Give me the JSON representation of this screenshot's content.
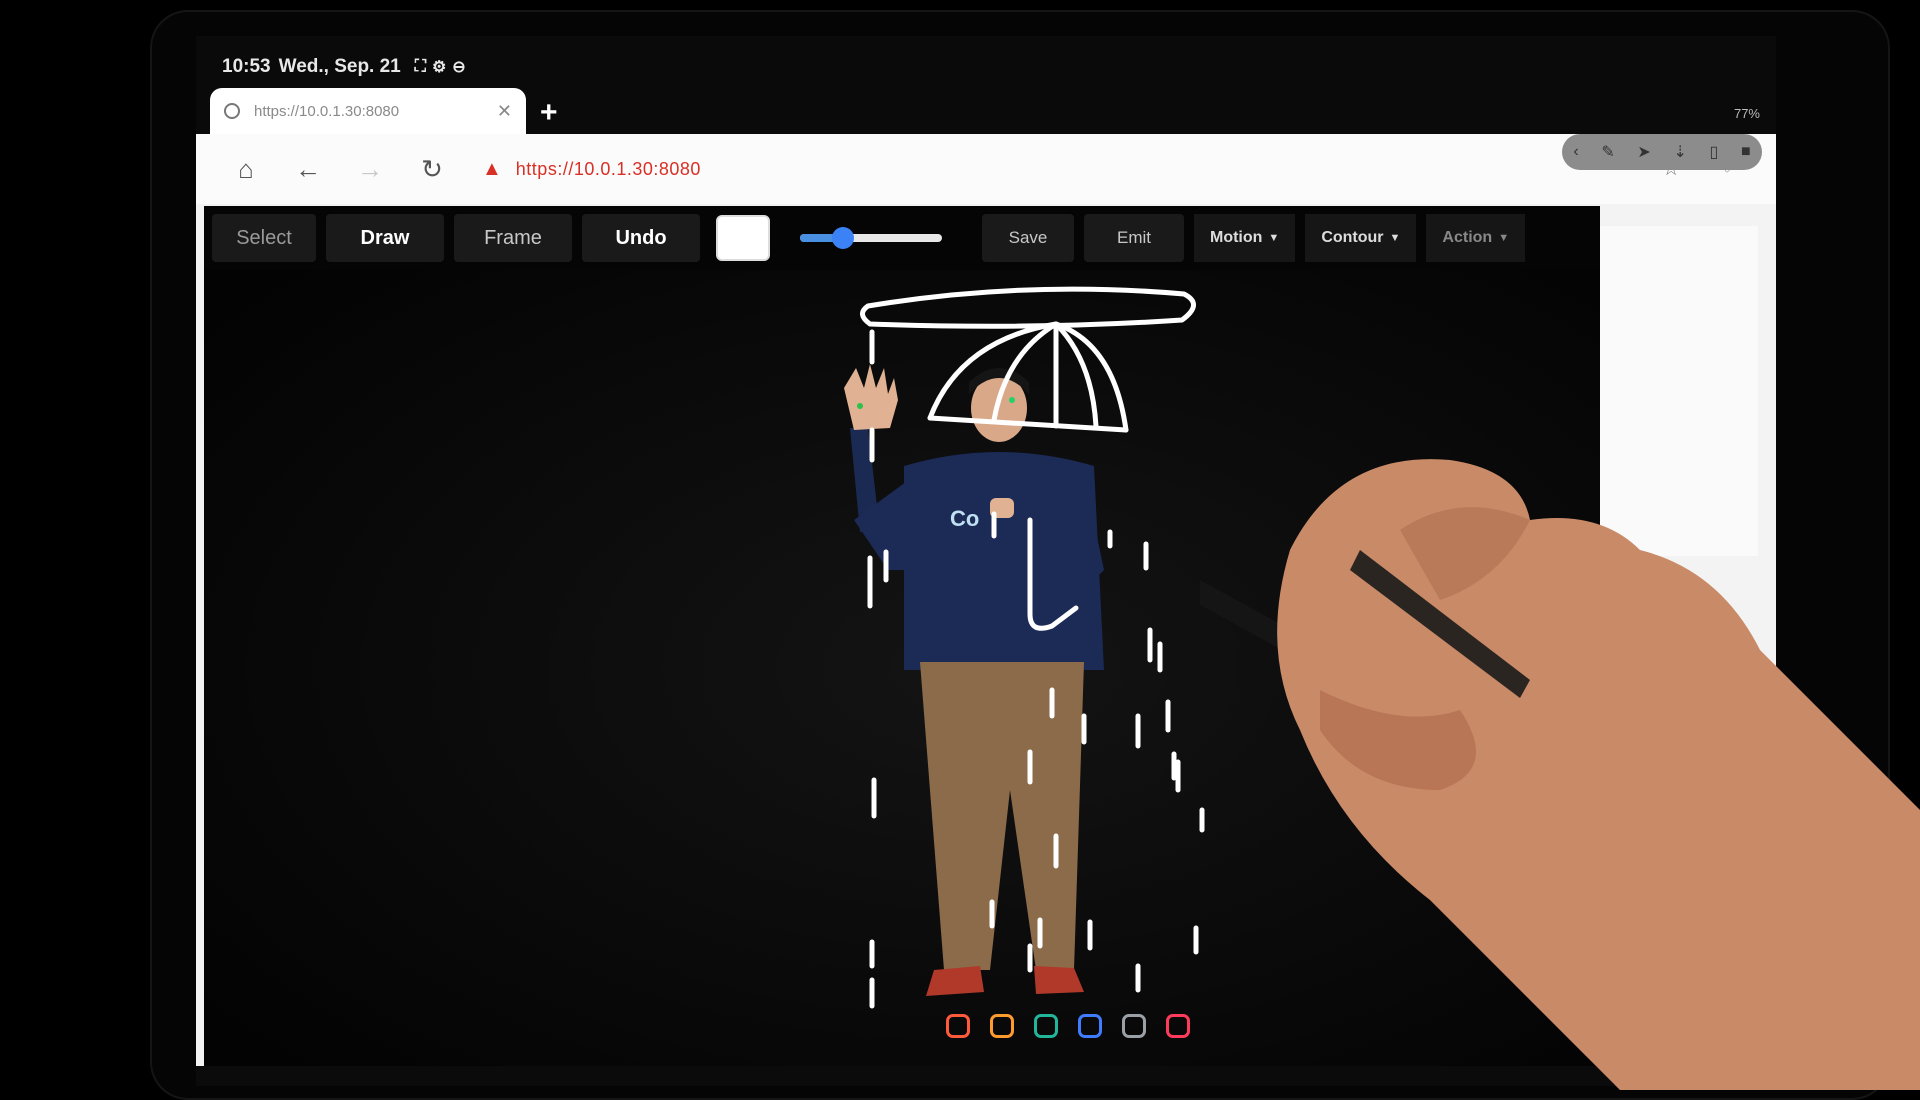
{
  "status_bar": {
    "time": "10:53",
    "date": "Wed., Sep. 21",
    "battery": "77%"
  },
  "browser": {
    "tab_title": "https://10.0.1.30:8080",
    "new_tab_label": "+",
    "url": "https://10.0.1.30:8080",
    "icons": [
      "home-icon",
      "back-icon",
      "forward-icon",
      "reload-icon",
      "warning-icon",
      "star-icon",
      "mic-icon"
    ]
  },
  "toolbar": {
    "select_label": "Select",
    "draw_label": "Draw",
    "frame_label": "Frame",
    "undo_label": "Undo",
    "color": "#ffffff",
    "brush_size": 0.3,
    "save_label": "Save",
    "emit_label": "Emit",
    "motion_label": "Motion",
    "contour_label": "Contour",
    "action_label": "Action"
  },
  "canvas": {
    "shirt_text": "Co",
    "drawing_color": "#ffffff"
  },
  "dock": {
    "icons": [
      {
        "name": "dock-app-1-icon",
        "color": "#ff5a3c"
      },
      {
        "name": "dock-app-2-icon",
        "color": "#ff9a2e"
      },
      {
        "name": "dock-app-3-icon",
        "color": "#22b59a"
      },
      {
        "name": "dock-app-4-icon",
        "color": "#3f7cff"
      },
      {
        "name": "dock-app-5-icon",
        "color": "#9aa0a6"
      },
      {
        "name": "dock-app-6-icon",
        "color": "#ff3b5c"
      }
    ]
  }
}
